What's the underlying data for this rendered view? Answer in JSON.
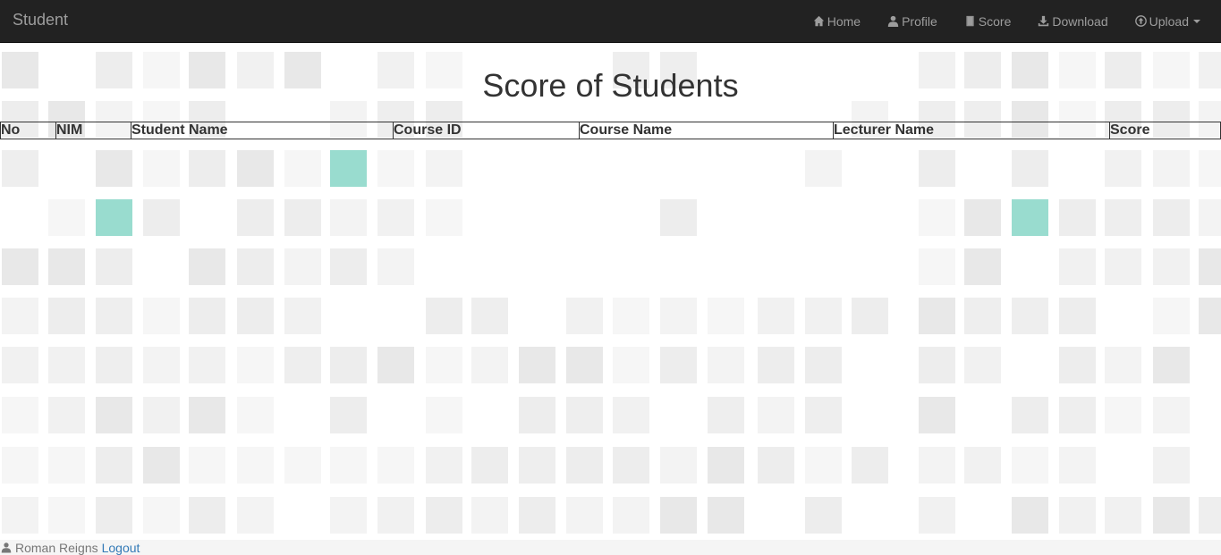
{
  "navbar": {
    "brand": "Student",
    "items": [
      {
        "label": "Home",
        "icon": "home-icon"
      },
      {
        "label": "Profile",
        "icon": "user-icon"
      },
      {
        "label": "Score",
        "icon": "book-icon"
      },
      {
        "label": "Download",
        "icon": "download-icon"
      },
      {
        "label": "Upload",
        "icon": "upload-icon"
      }
    ]
  },
  "page": {
    "title": "Score of Students"
  },
  "table": {
    "columns": [
      "No",
      "NIM",
      "Student Name",
      "Course ID",
      "Course Name",
      "Lecturer Name",
      "Score"
    ]
  },
  "footer": {
    "user_name": "Roman Reigns",
    "logout_label": "Logout"
  },
  "colors": {
    "navbar_bg": "#222222",
    "nav_text": "#9d9d9d",
    "accent_tile": "#99dccf",
    "link": "#337ab7"
  }
}
